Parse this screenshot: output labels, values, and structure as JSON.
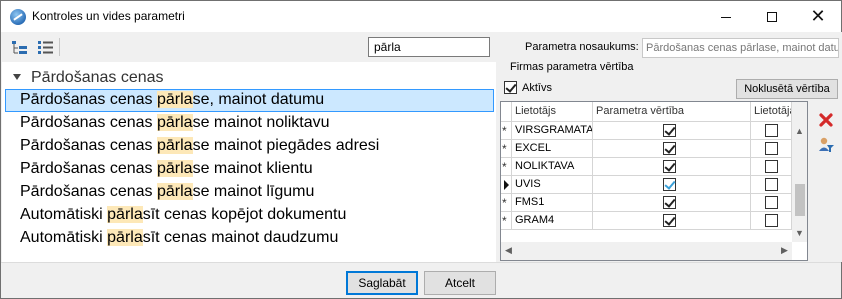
{
  "window": {
    "title": "Kontroles un vides parametri"
  },
  "search": {
    "value": "pārla"
  },
  "tree": {
    "group_label": "Pārdošanas cenas",
    "items": [
      {
        "pre": "Pārdošanas cenas ",
        "hl": "pārla",
        "post": "se, mainot datumu",
        "selected": true
      },
      {
        "pre": "Pārdošanas cenas ",
        "hl": "pārla",
        "post": "se mainot noliktavu"
      },
      {
        "pre": "Pārdošanas cenas ",
        "hl": "pārla",
        "post": "se mainot piegādes adresi"
      },
      {
        "pre": "Pārdošanas cenas ",
        "hl": "pārla",
        "post": "se mainot klientu"
      },
      {
        "pre": "Pārdošanas cenas ",
        "hl": "pārla",
        "post": "se mainot līgumu"
      },
      {
        "pre": "Automātiski ",
        "hl": "pārla",
        "post": "sīt cenas kopējot dokumentu"
      },
      {
        "pre": "Automātiski ",
        "hl": "pārla",
        "post": "sīt cenas mainot daudzumu"
      }
    ]
  },
  "param": {
    "name_label": "Parametra nosaukums:",
    "name_value": "Pārdošanas cenas pārlase, mainot datun",
    "firm_value_label": "Firmas parametra vērtība",
    "active_label": "Aktīvs",
    "active": true,
    "default_button": "Noklusētā vērtība"
  },
  "grid": {
    "columns": [
      "Lietotājs",
      "Parametra vērtība",
      "Lietotāja"
    ],
    "rows": [
      {
        "marker": "*",
        "user": "VIRSGRAMATA",
        "value": true,
        "user_val": false
      },
      {
        "marker": "*",
        "user": "EXCEL",
        "value": true,
        "user_val": false
      },
      {
        "marker": "*",
        "user": "NOLIKTAVA",
        "value": true,
        "user_val": false
      },
      {
        "marker": "arrow",
        "user": "UVIS",
        "value": true,
        "user_val": false,
        "current": true
      },
      {
        "marker": "*",
        "user": "FMS1",
        "value": true,
        "user_val": false
      },
      {
        "marker": "*",
        "user": "GRAM4",
        "value": true,
        "user_val": false
      }
    ]
  },
  "icons": {
    "tree_expand": "tree-expand-icon",
    "tree_list": "list-icon",
    "delete": "delete-x-icon",
    "user_filter": "user-filter-icon"
  },
  "buttons": {
    "save": "Saglabāt",
    "cancel": "Atcelt"
  }
}
